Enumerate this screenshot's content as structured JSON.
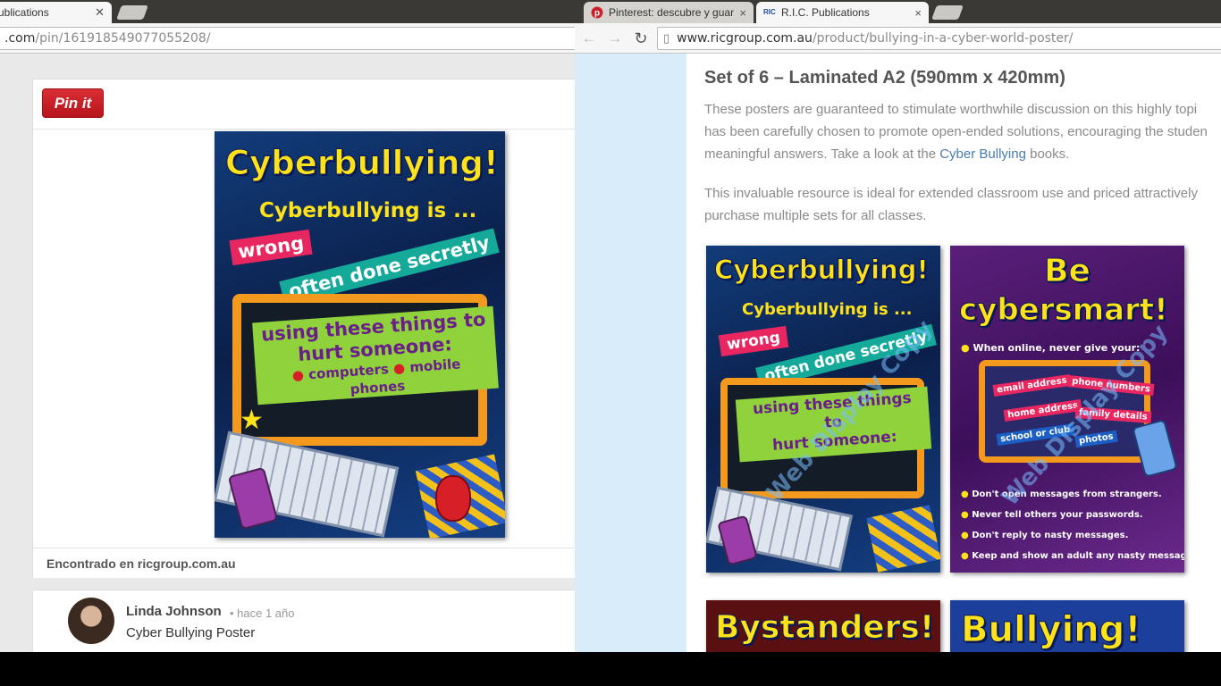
{
  "left_window": {
    "tab_title": "ublications",
    "url_domain": ".com",
    "url_path": "/pin/161918549077055208/",
    "pin_button": "Pin it",
    "pin_source": "Encontrado en ricgroup.com.au",
    "comment": {
      "author": "Linda Johnson",
      "time": "• hace 1 año",
      "text": "Cyber Bullying Poster"
    }
  },
  "right_window": {
    "tabs": [
      {
        "label": "Pinterest: descubre y guar",
        "icon": "pinterest-icon",
        "close": "×"
      },
      {
        "label": "R.I.C. Publications",
        "icon": "ric-icon",
        "close": "×"
      }
    ],
    "url_domain": "www.ricgroup.com.au",
    "url_path": "/product/bullying-in-a-cyber-world-poster/",
    "heading": "Set of 6 – Laminated A2 (590mm x 420mm)",
    "para1": {
      "line1": "These posters are guaranteed to stimulate worthwhile discussion on this highly topi",
      "line2": "has been carefully chosen to promote open-ended solutions, encouraging the studen",
      "line3_pre": "meaningful answers. Take a look at the ",
      "link": "Cyber Bullying",
      "line3_post": " books."
    },
    "para2": {
      "line1": "This invaluable resource is ideal for extended classroom use and priced attractively",
      "line2": "purchase multiple sets for all classes."
    }
  },
  "posters": {
    "cyberbullying": {
      "title": "Cyberbullying!",
      "subtitle": "Cyberbullying is ...",
      "band1": "wrong",
      "band2": "often done secretly",
      "band3_line1": "using these things to",
      "band3_line2": "hurt someone:",
      "bullet1": "computers",
      "bullet2": "mobile phones"
    },
    "cybersmart": {
      "title_line1": "Be",
      "title_line2": "cybersmart!",
      "intro": "When online, never give your:",
      "tags": [
        "email address",
        "phone numbers",
        "home address",
        "family details",
        "school or club",
        "photos"
      ],
      "tips": [
        "Don't open messages from strangers.",
        "Never tell others your passwords.",
        "Don't reply to nasty messages.",
        "Keep and show an adult any nasty messages."
      ]
    },
    "bystanders": {
      "title": "Bystanders!"
    },
    "bullying": {
      "title": "Bullying!"
    },
    "watermark": "Web Display Copy"
  },
  "colors": {
    "pin_red": "#cb2027",
    "link_blue": "#4a7bb0",
    "sidebar_blue": "#d9ecf9",
    "poster_yellow": "#ffe21a"
  }
}
